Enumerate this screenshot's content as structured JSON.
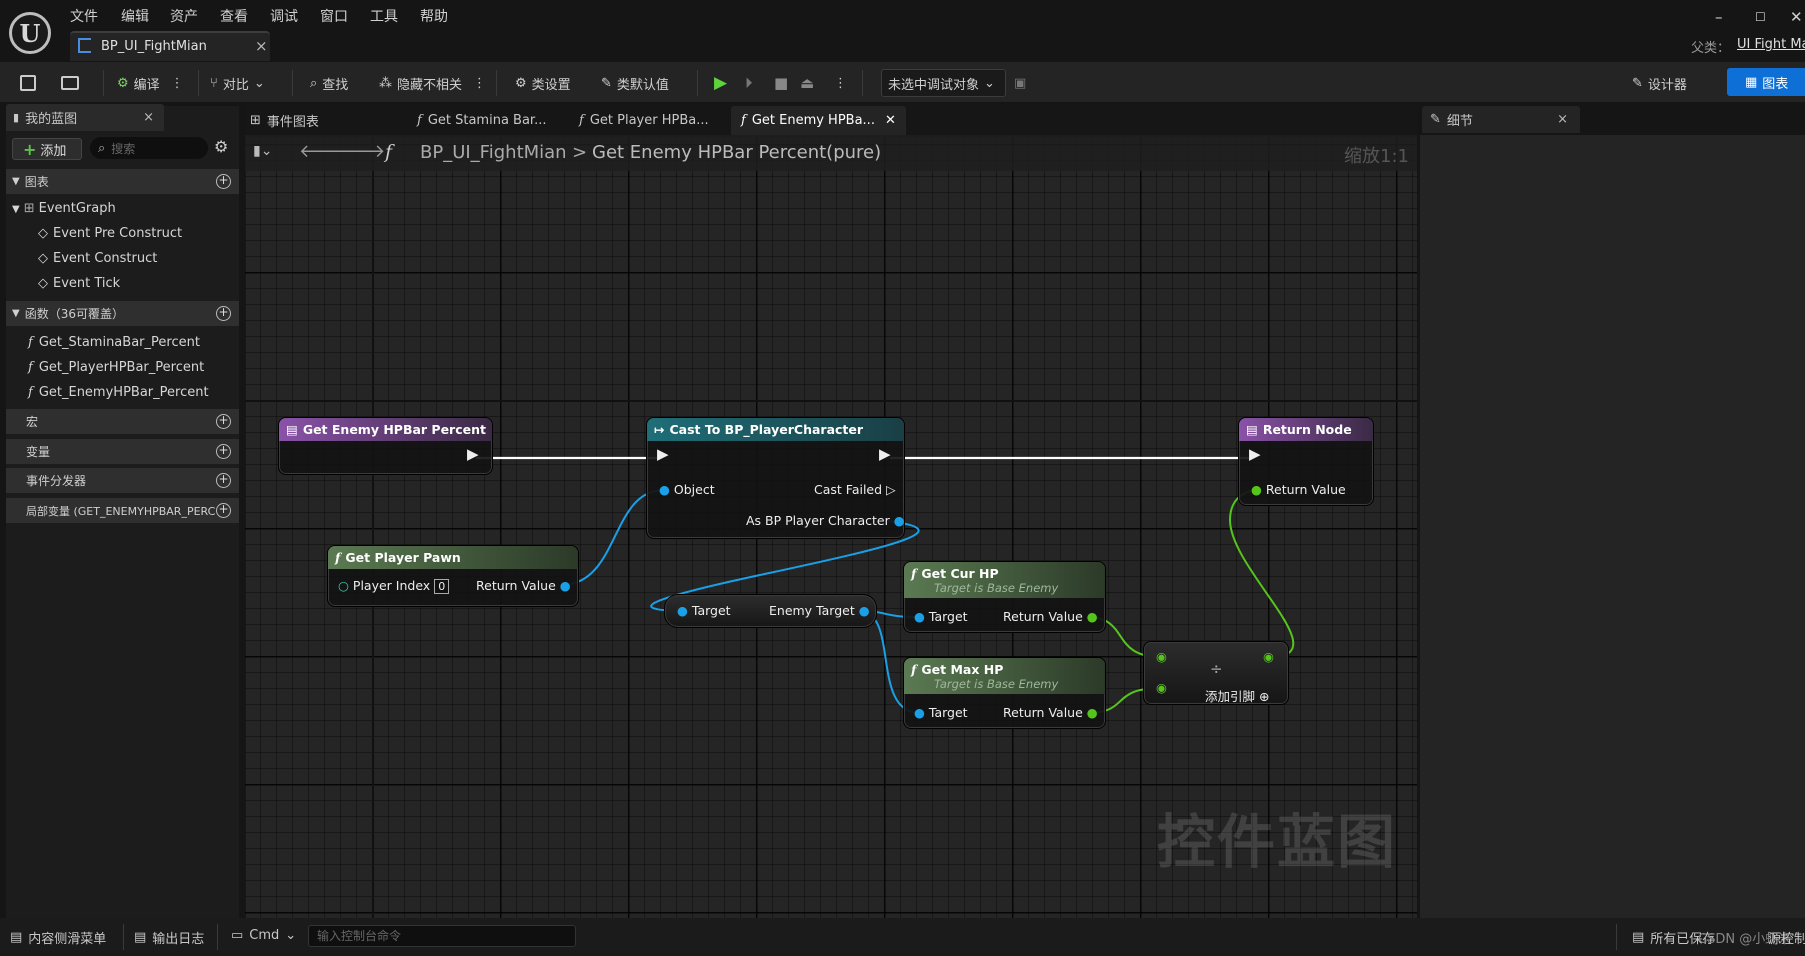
{
  "menu": [
    "文件",
    "编辑",
    "资产",
    "查看",
    "调试",
    "窗口",
    "工具",
    "帮助"
  ],
  "window": {
    "minimize": "–",
    "maximize": "☐",
    "close": "✕"
  },
  "document_tab": {
    "label": "BP_UI_FightMian",
    "close": "×"
  },
  "parent": {
    "label": "父类：",
    "value": "UI Fight Mai"
  },
  "toolbar": {
    "compile": "编译",
    "diff": "对比",
    "find": "查找",
    "hide_unrelated": "隐藏不相关",
    "class_settings": "类设置",
    "class_defaults": "类默认值",
    "debug_object": "未选中调试对象",
    "designer": "设计器",
    "graph": "图表"
  },
  "my_blueprint": {
    "tab": "我的蓝图",
    "close": "×",
    "add": "添加",
    "search_placeholder": "搜索",
    "sections": {
      "graphs": "图表",
      "functions": "函数（36可覆盖）",
      "macros": "宏",
      "variables": "变量",
      "dispatchers": "事件分发器",
      "local_vars": "局部变量 (GET_ENEMYHPBAR_PERCE"
    },
    "event_graph": "EventGraph",
    "events": [
      "Event Pre Construct",
      "Event Construct",
      "Event Tick"
    ],
    "functions": [
      "Get_StaminaBar_Percent",
      "Get_PlayerHPBar_Percent",
      "Get_EnemyHPBar_Percent"
    ]
  },
  "graph_tabs": [
    "事件图表",
    "Get Stamina Bar...",
    "Get Player HPBa...",
    "Get Enemy HPBa..."
  ],
  "breadcrumb": {
    "root": "BP_UI_FightMian",
    "sep": ">",
    "current": "Get Enemy HPBar Percent(pure)",
    "zoom": "缩放1:1"
  },
  "watermark": "控件蓝图",
  "nodes": {
    "entry": {
      "title": "Get Enemy HPBar Percent"
    },
    "cast": {
      "title": "Cast To BP_PlayerCharacter",
      "object": "Object",
      "cast_failed": "Cast Failed",
      "as": "As BP Player Character"
    },
    "return": {
      "title": "Return Node",
      "value": "Return Value"
    },
    "pawn": {
      "title": "Get Player Pawn",
      "index_label": "Player Index",
      "index_value": "0",
      "ret": "Return Value"
    },
    "enemy_target": {
      "target": "Target",
      "out": "Enemy Target"
    },
    "cur_hp": {
      "title": "Get Cur HP",
      "sub": "Target is Base Enemy",
      "target": "Target",
      "ret": "Return Value"
    },
    "max_hp": {
      "title": "Get Max HP",
      "sub": "Target is Base Enemy",
      "target": "Target",
      "ret": "Return Value"
    },
    "divide": {
      "symbol": "÷",
      "add_pin": "添加引脚"
    }
  },
  "details": {
    "tab": "细节",
    "close": "×"
  },
  "status": {
    "drawer": "内容侧滑菜单",
    "output": "输出日志",
    "cmd": "Cmd",
    "console_placeholder": "输入控制台命令",
    "saved": "所有已保存",
    "revision": "CSDN @小虾米",
    "source_control": "源控制"
  },
  "colors": {
    "exec": "#ffffff",
    "object": "#1aa0e6",
    "float": "#55c51c",
    "pure_head": "#4e6a45",
    "entry_head": "#7a4a92",
    "cast_head": "#1c5a63",
    "accent": "#0e6fd6"
  }
}
